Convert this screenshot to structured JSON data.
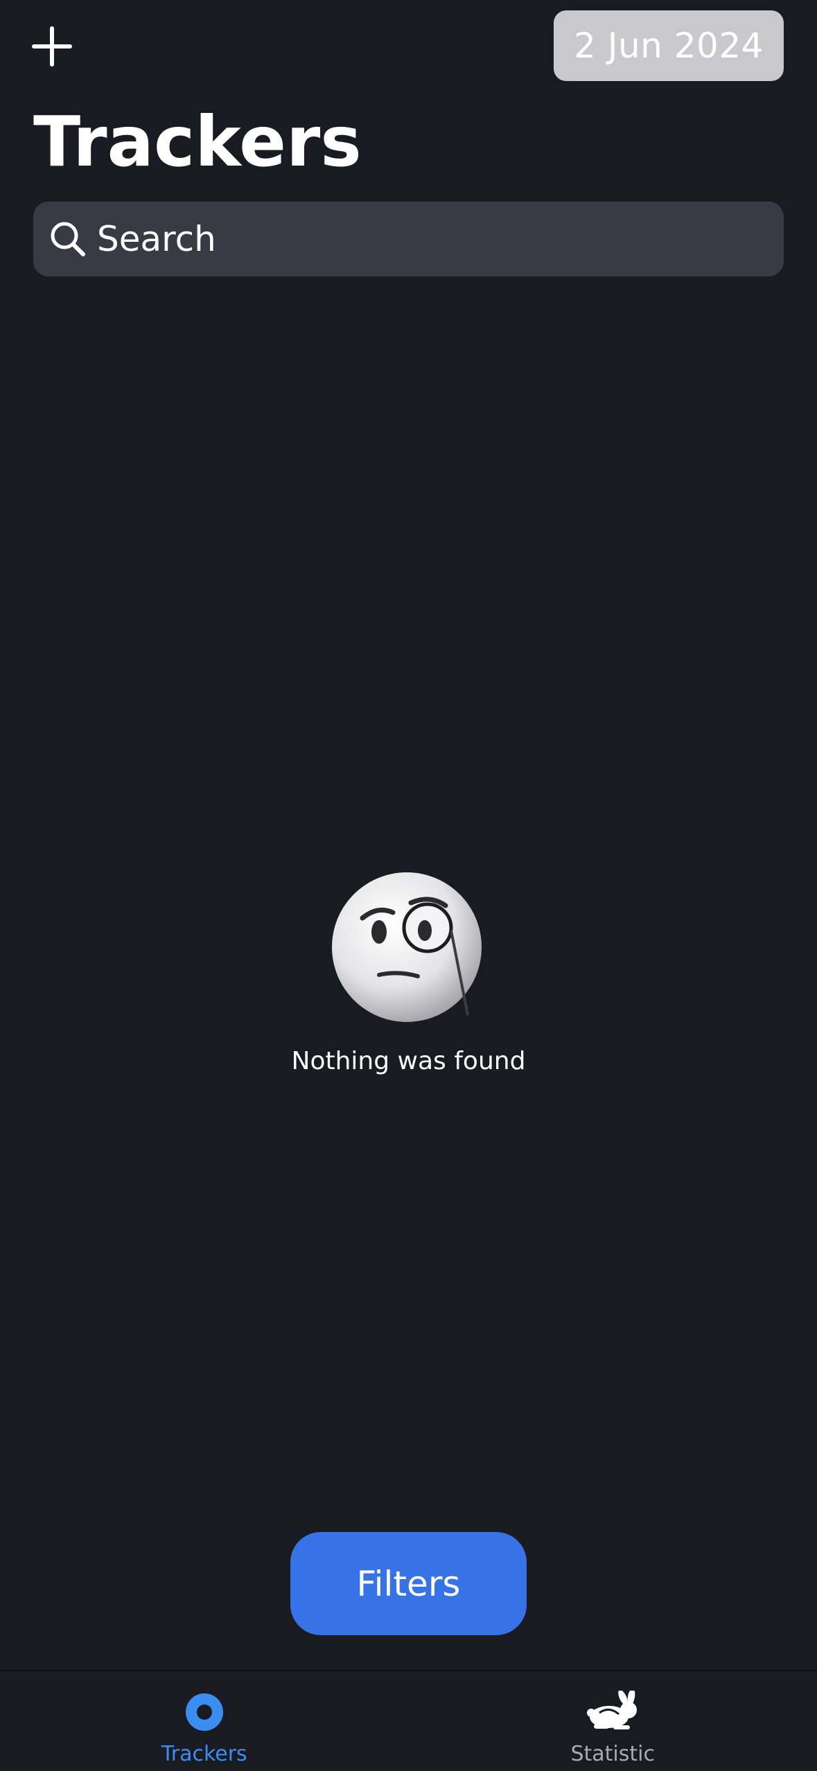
{
  "header": {
    "add_icon": "plus-icon",
    "date": "2 Jun 2024",
    "title": "Trackers"
  },
  "search": {
    "icon": "magnifier-icon",
    "placeholder": "Search"
  },
  "empty_state": {
    "icon": "monocle-face-emoji",
    "message": "Nothing was found"
  },
  "filters": {
    "label": "Filters",
    "color": "#3772e7"
  },
  "tab_bar": {
    "tabs": [
      {
        "label": "Trackers",
        "icon": "trackers-ring-icon",
        "active": true,
        "color": "#3a8ef0"
      },
      {
        "label": "Statistic",
        "icon": "rabbit-icon",
        "active": false,
        "color": "#a9a9b0"
      }
    ]
  },
  "colors": {
    "background": "#1a1b22",
    "search_field": "#393a44",
    "date_chip": "#c9c9cc",
    "accent": "#3772e7"
  }
}
